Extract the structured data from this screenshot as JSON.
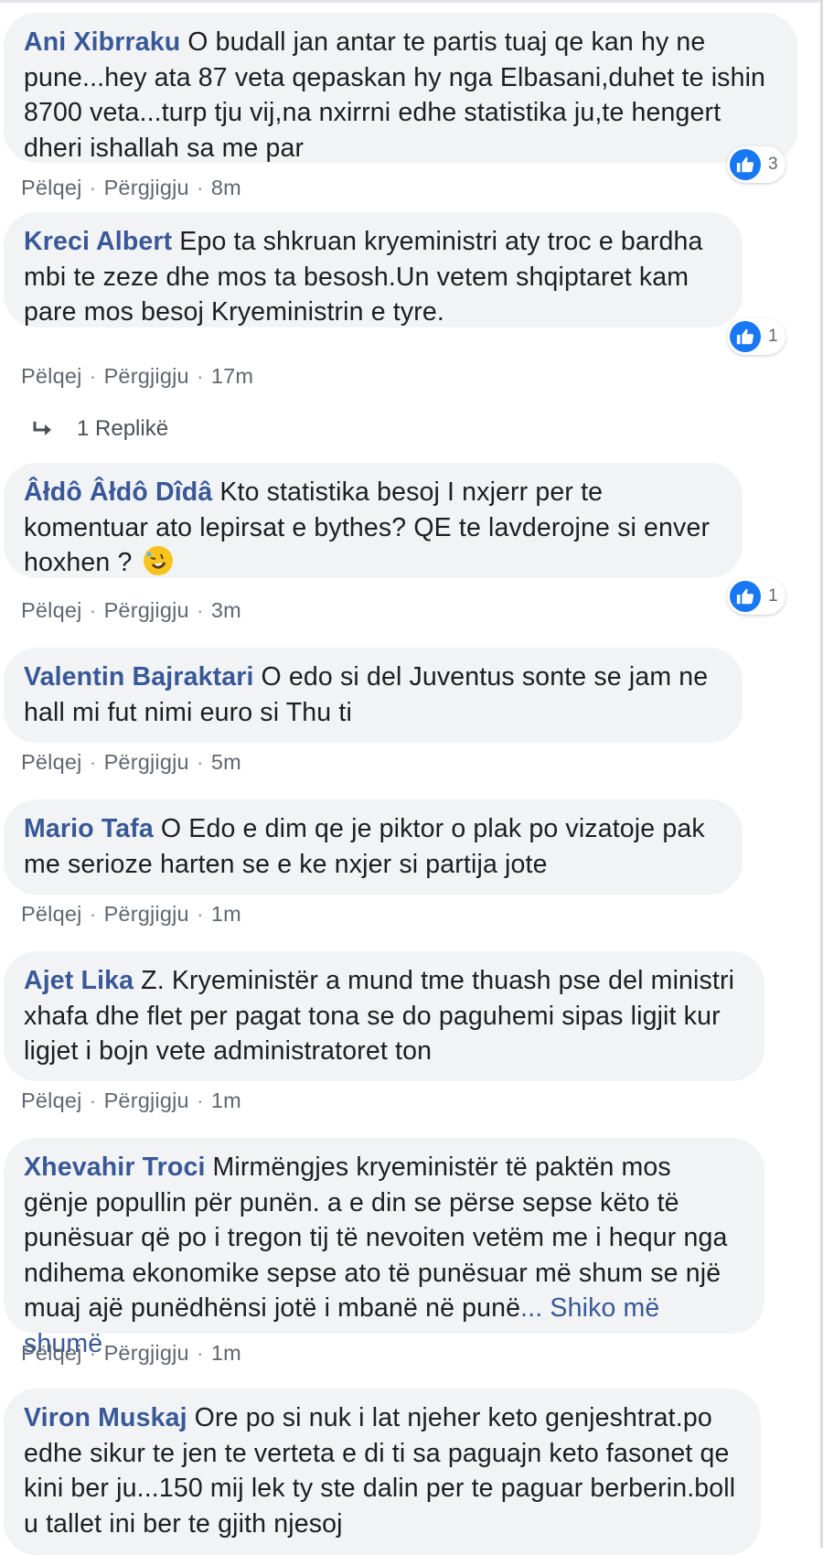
{
  "comments": [
    {
      "author": "Ani Xibrraku",
      "text": "O budall jan antar te partis tuaj qe kan hy ne pune...hey ata 87 veta qepaskan hy nga Elbasani,duhet te ishin 8700 veta...turp tju vij,na nxirrni edhe statistika ju,te hengert dheri ishallah sa me par",
      "like_label": "Pëlqej",
      "reply_label": "Përgjigju",
      "time": "8m",
      "reaction_count": "3"
    },
    {
      "author": "Kreci Albert",
      "text": "Epo ta shkruan kryeministri aty troc e bardha mbi te zeze dhe mos ta besosh.Un vetem shqiptaret kam pare mos besoj Kryeministrin e tyre.",
      "like_label": "Pëlqej",
      "reply_label": "Përgjigju",
      "time": "17m",
      "reaction_count": "1",
      "replies_label": "1 Replikë"
    },
    {
      "author": "Âłdô Âłdô Dîdâ",
      "text": "Kto statistika besoj I nxjerr per te komentuar ato lepirsat e bythes? QE te lavderojne si enver hoxhen ?",
      "emoji": "rolling-on-floor-laughing",
      "like_label": "Pëlqej",
      "reply_label": "Përgjigju",
      "time": "3m",
      "reaction_count": "1"
    },
    {
      "author": "Valentin Bajraktari",
      "text": "O edo si del Juventus sonte se jam ne hall mi fut nimi euro si Thu ti",
      "like_label": "Pëlqej",
      "reply_label": "Përgjigju",
      "time": "5m"
    },
    {
      "author": "Mario Tafa",
      "text": "O Edo e dim qe je piktor o plak po vizatoje pak me serioze harten se e ke nxjer si partija jote",
      "like_label": "Pëlqej",
      "reply_label": "Përgjigju",
      "time": "1m"
    },
    {
      "author": "Ajet Lika",
      "text": "Z. Kryeministër a mund tme thuash pse del ministri xhafa dhe flet per pagat tona se do paguhemi sipas ligjit kur ligjet i bojn vete administratoret ton",
      "like_label": "Pëlqej",
      "reply_label": "Përgjigju",
      "time": "1m"
    },
    {
      "author": "Xhevahir Troci",
      "text": "Mirmëngjes kryeministër të paktën mos gënje popullin për punën. a e din se përse sepse këto të punësuar që po i tregon tij të nevoiten vetëm me i hequr nga ndihema ekonomike sepse ato të punësuar më shum se një muaj ajë punëdhënsi jotë i mbanë në punë",
      "see_more": "... Shiko më shumë",
      "like_label": "Pëlqej",
      "reply_label": "Përgjigju",
      "time": "1m"
    },
    {
      "author": "Viron Muskaj",
      "text": "Ore po si nuk i lat njeher keto genjeshtrat.po edhe sikur te jen te verteta e di ti sa paguajn keto fasonet qe kini ber ju...150 mij lek ty ste dalin per te paguar berberin.boll u tallet ini ber te gjith njesoj"
    }
  ],
  "colors": {
    "author": "#385898",
    "bubble": "#f2f3f5",
    "like_blue": "#1877f2",
    "meta": "#606770"
  }
}
